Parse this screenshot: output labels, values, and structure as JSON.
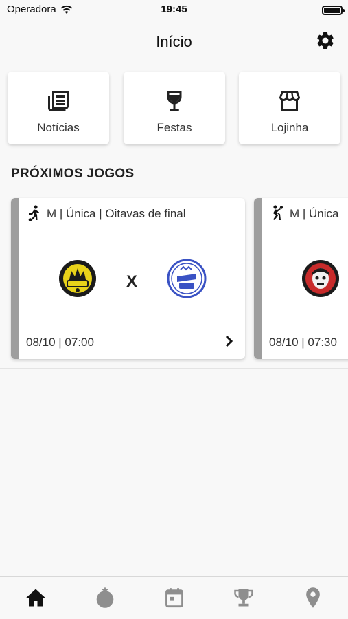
{
  "status_bar": {
    "carrier": "Operadora",
    "time": "19:45"
  },
  "nav": {
    "title": "Início",
    "settings_icon": "gear-icon"
  },
  "shortcuts": [
    {
      "label": "Notícias",
      "icon": "newspaper-icon"
    },
    {
      "label": "Festas",
      "icon": "wine-glass-icon"
    },
    {
      "label": "Lojinha",
      "icon": "storefront-icon"
    }
  ],
  "section": {
    "title": "PRÓXIMOS JOGOS"
  },
  "games": [
    {
      "sport_icon": "soccer-player-icon",
      "header": "M | Única | Oitavas de final",
      "versus": "X",
      "datetime": "08/10 | 07:00",
      "home_logo": "yellow-black-team-crest",
      "away_logo": "blue-white-team-crest"
    },
    {
      "sport_icon": "handball-player-icon",
      "header": "M | Única",
      "datetime": "08/10 | 07:30",
      "home_logo": "red-black-team-crest"
    }
  ],
  "tabs": [
    {
      "name": "home",
      "icon": "home-icon",
      "active": true
    },
    {
      "name": "sports",
      "icon": "ball-icon",
      "active": false
    },
    {
      "name": "calendar",
      "icon": "calendar-icon",
      "active": false
    },
    {
      "name": "trophy",
      "icon": "trophy-icon",
      "active": false
    },
    {
      "name": "location",
      "icon": "location-pin-icon",
      "active": false
    }
  ],
  "colors": {
    "background": "#f8f8f8",
    "card_accent": "#9e9e9e",
    "tab_active": "#111111",
    "tab_inactive": "#8e8e8e"
  }
}
